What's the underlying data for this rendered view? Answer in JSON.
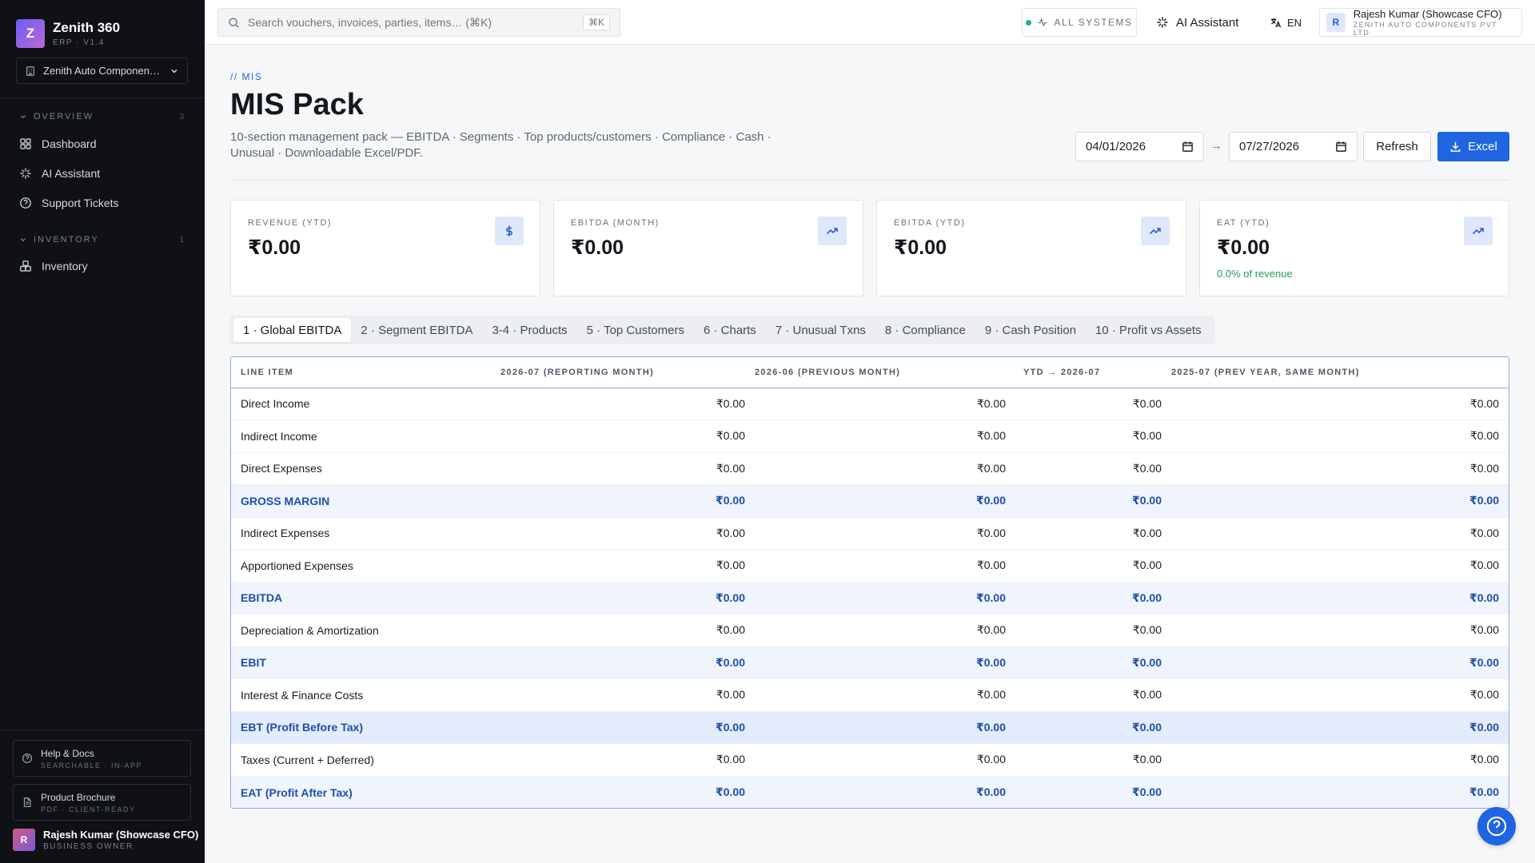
{
  "sidebar": {
    "brand": {
      "logo_letter": "Z",
      "name": "Zenith 360",
      "version": "ERP · V1.4"
    },
    "company": "Zenith Auto Components ...",
    "sections": [
      {
        "label": "OVERVIEW",
        "count": "3",
        "items": [
          "Dashboard",
          "AI Assistant",
          "Support Tickets"
        ]
      },
      {
        "label": "INVENTORY",
        "count": "1",
        "items": [
          "Inventory"
        ]
      }
    ],
    "footer": {
      "help": {
        "title": "Help & Docs",
        "sub": "SEARCHABLE · IN-APP"
      },
      "brochure": {
        "title": "Product Brochure",
        "sub": "PDF · CLIENT-READY"
      },
      "user": {
        "initial": "R",
        "name": "Rajesh Kumar (Showcase CFO)",
        "role": "BUSINESS OWNER"
      }
    }
  },
  "topbar": {
    "search_placeholder": "Search vouchers, invoices, parties, items… (⌘K)",
    "search_shortcut": "⌘K",
    "systems_label": "ALL SYSTEMS",
    "ai_label": "AI Assistant",
    "lang_label": "EN",
    "user": {
      "initial": "R",
      "name": "Rajesh Kumar (Showcase CFO)",
      "company": "ZENITH AUTO COMPONENTS PVT LTD"
    }
  },
  "page": {
    "breadcrumb": "// MIS",
    "title": "MIS Pack",
    "description": "10-section management pack — EBITDA · Segments · Top products/customers · Compliance · Cash · Unusual · Downloadable Excel/PDF.",
    "date_from": "04/01/2026",
    "date_to": "07/27/2026",
    "arrow": "→",
    "refresh_label": "Refresh",
    "excel_label": "Excel"
  },
  "kpis": [
    {
      "label": "REVENUE (YTD)",
      "value": "₹0.00",
      "sub": "",
      "icon": "dollar-icon"
    },
    {
      "label": "EBITDA (MONTH)",
      "value": "₹0.00",
      "sub": "",
      "icon": "trend-up-icon"
    },
    {
      "label": "EBITDA (YTD)",
      "value": "₹0.00",
      "sub": "",
      "icon": "trend-up-icon"
    },
    {
      "label": "EAT (YTD)",
      "value": "₹0.00",
      "sub": "0.0% of revenue",
      "icon": "trend-up-icon"
    }
  ],
  "tabs": [
    "1 · Global EBITDA",
    "2 · Segment EBITDA",
    "3-4 · Products",
    "5 · Top Customers",
    "6 · Charts",
    "7 · Unusual Txns",
    "8 · Compliance",
    "9 · Cash Position",
    "10 · Profit vs Assets"
  ],
  "active_tab": 0,
  "table": {
    "headers": [
      "LINE ITEM",
      "2026-07 (REPORTING MONTH)",
      "2026-06 (PREVIOUS MONTH)",
      "YTD → 2026-07",
      "2025-07 (PREV YEAR, SAME MONTH)"
    ],
    "rows": [
      {
        "item": "Direct Income",
        "values": [
          "₹0.00",
          "₹0.00",
          "₹0.00",
          "₹0.00"
        ],
        "style": ""
      },
      {
        "item": "Indirect Income",
        "values": [
          "₹0.00",
          "₹0.00",
          "₹0.00",
          "₹0.00"
        ],
        "style": ""
      },
      {
        "item": "Direct Expenses",
        "values": [
          "₹0.00",
          "₹0.00",
          "₹0.00",
          "₹0.00"
        ],
        "style": ""
      },
      {
        "item": "GROSS MARGIN",
        "values": [
          "₹0.00",
          "₹0.00",
          "₹0.00",
          "₹0.00"
        ],
        "style": "hl"
      },
      {
        "item": "Indirect Expenses",
        "values": [
          "₹0.00",
          "₹0.00",
          "₹0.00",
          "₹0.00"
        ],
        "style": ""
      },
      {
        "item": "Apportioned Expenses",
        "values": [
          "₹0.00",
          "₹0.00",
          "₹0.00",
          "₹0.00"
        ],
        "style": ""
      },
      {
        "item": "EBITDA",
        "values": [
          "₹0.00",
          "₹0.00",
          "₹0.00",
          "₹0.00"
        ],
        "style": "hl"
      },
      {
        "item": "Depreciation & Amortization",
        "values": [
          "₹0.00",
          "₹0.00",
          "₹0.00",
          "₹0.00"
        ],
        "style": ""
      },
      {
        "item": "EBIT",
        "values": [
          "₹0.00",
          "₹0.00",
          "₹0.00",
          "₹0.00"
        ],
        "style": "hl"
      },
      {
        "item": "Interest & Finance Costs",
        "values": [
          "₹0.00",
          "₹0.00",
          "₹0.00",
          "₹0.00"
        ],
        "style": ""
      },
      {
        "item": "EBT (Profit Before Tax)",
        "values": [
          "₹0.00",
          "₹0.00",
          "₹0.00",
          "₹0.00"
        ],
        "style": "hl2"
      },
      {
        "item": "Taxes (Current + Deferred)",
        "values": [
          "₹0.00",
          "₹0.00",
          "₹0.00",
          "₹0.00"
        ],
        "style": ""
      },
      {
        "item": "EAT (Profit After Tax)",
        "values": [
          "₹0.00",
          "₹0.00",
          "₹0.00",
          "₹0.00"
        ],
        "style": "hl"
      }
    ]
  },
  "colors": {
    "accent": "#1f64e0",
    "sidebar_bg": "#0f1115",
    "highlight_row": "#eff4fd",
    "positive": "#1f9d5a"
  }
}
